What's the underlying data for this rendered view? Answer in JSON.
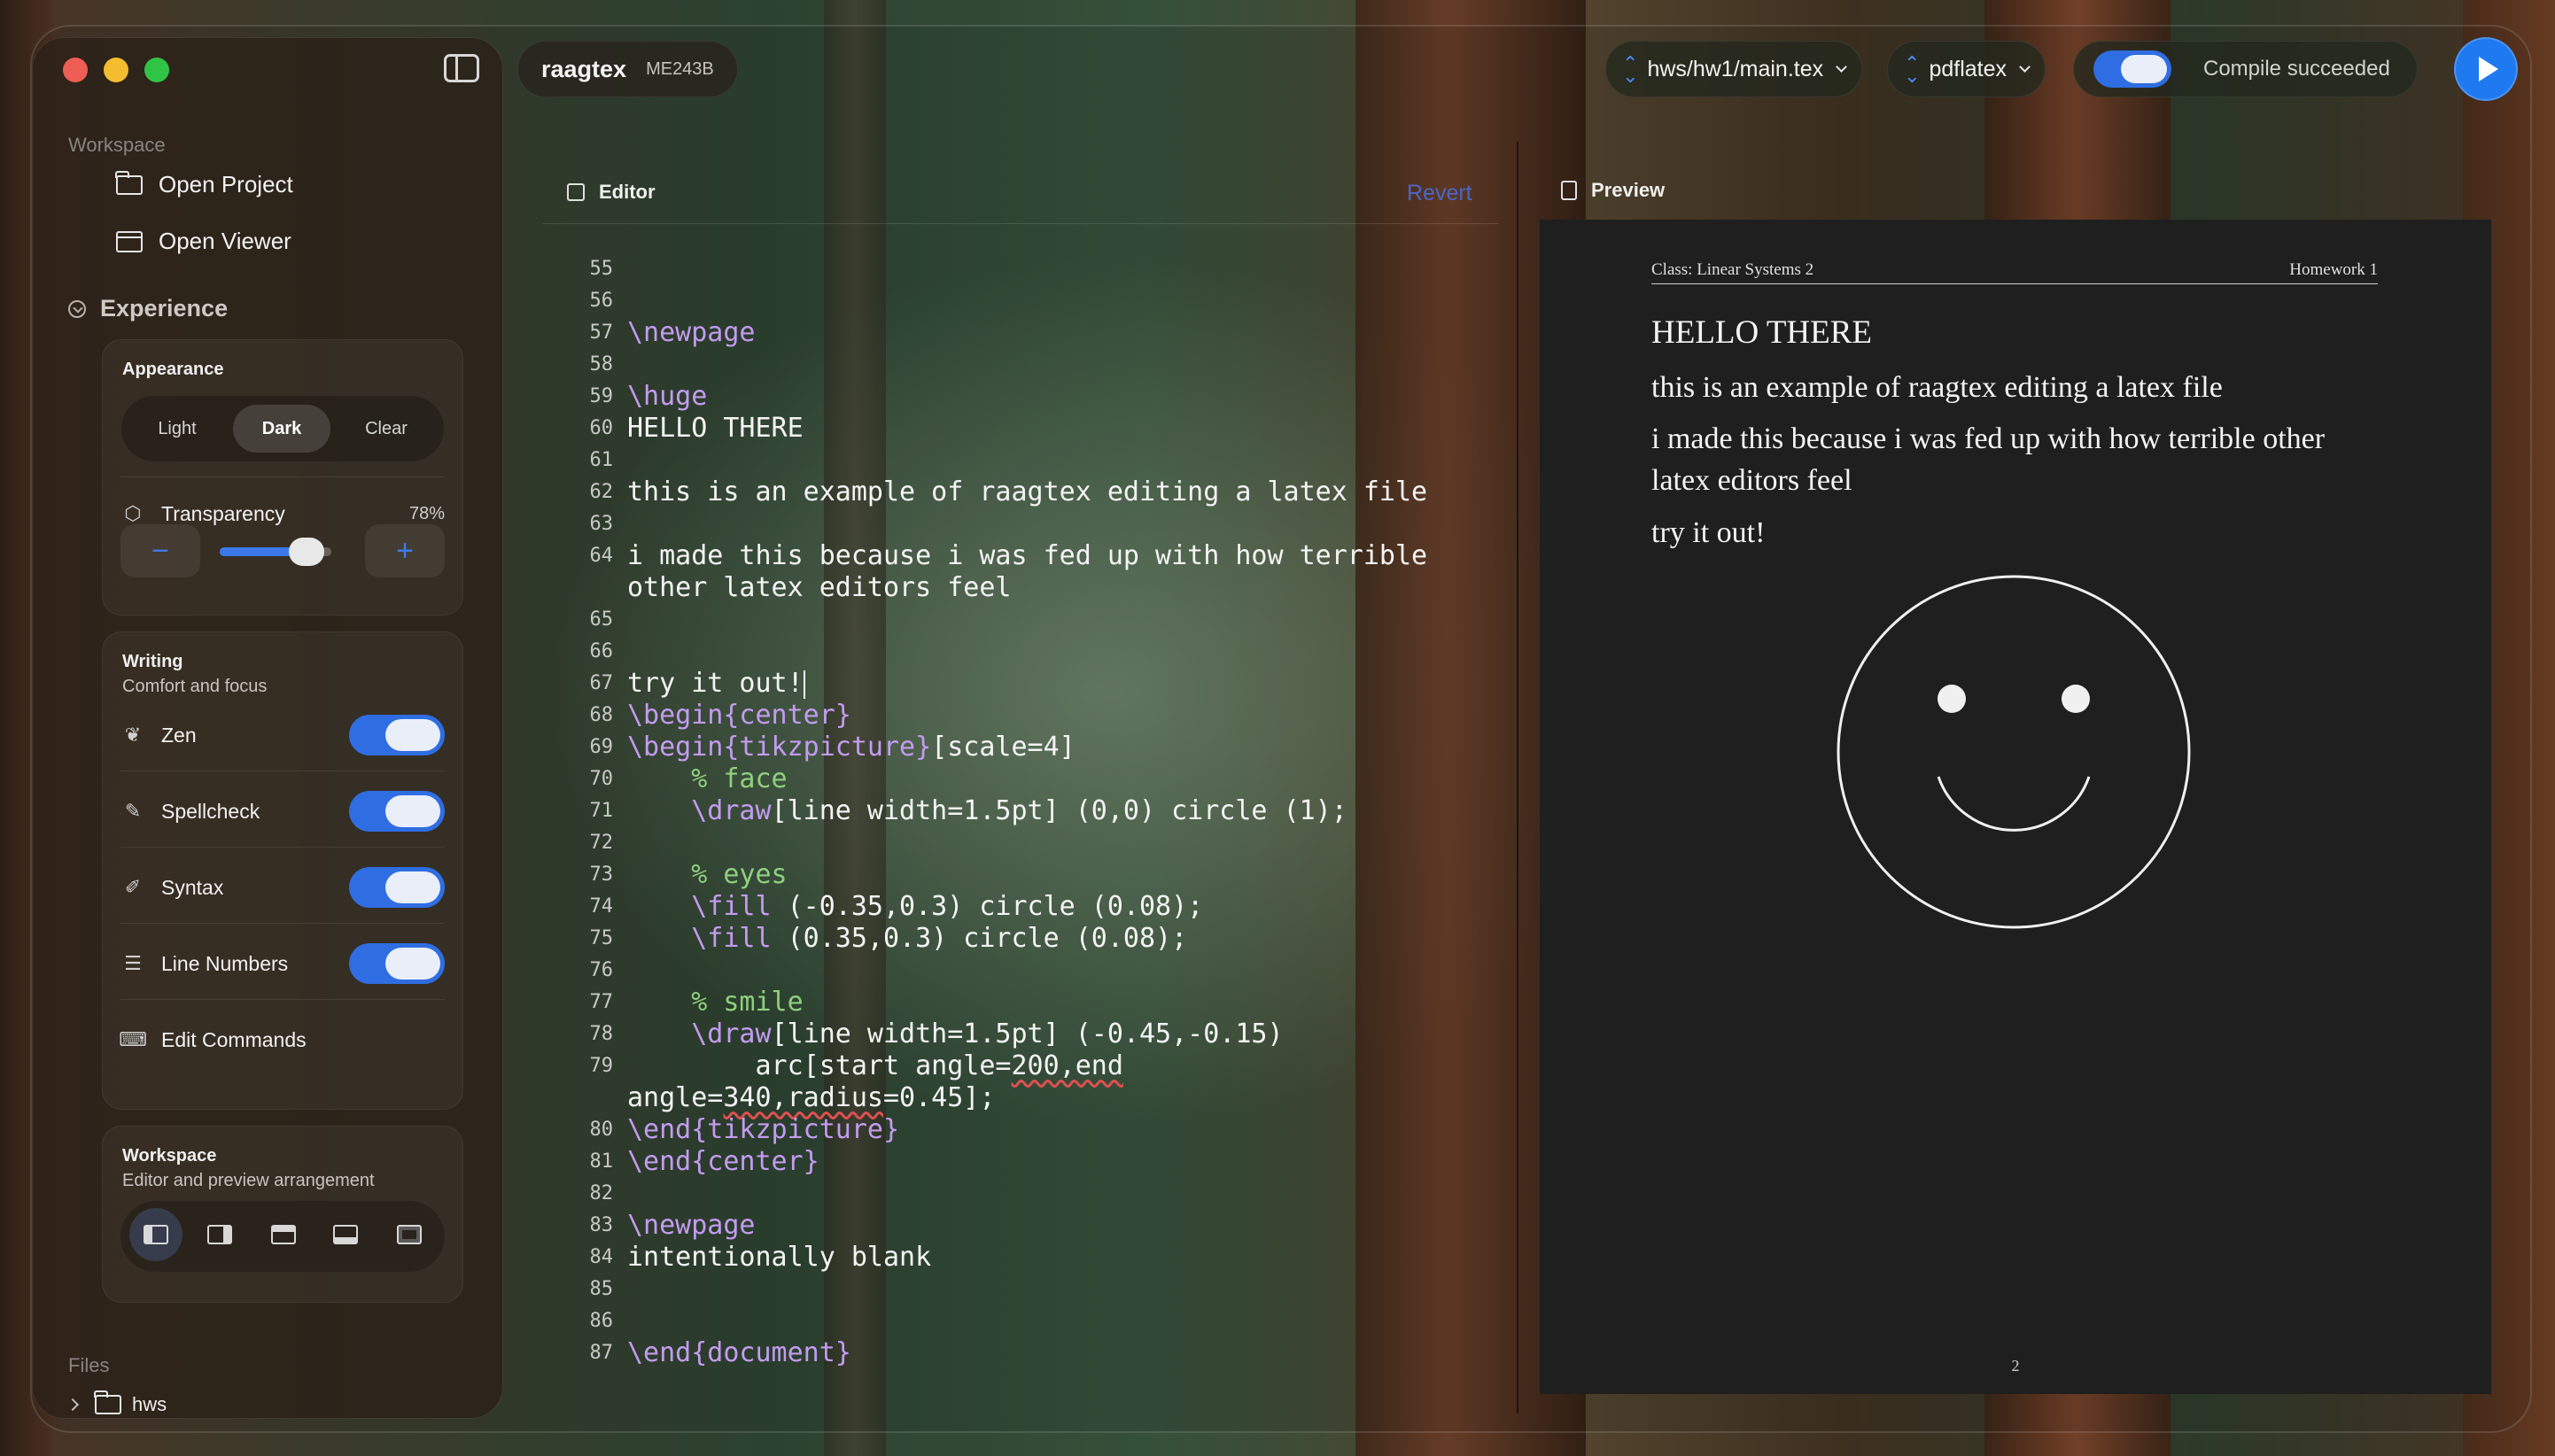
{
  "sidebar": {
    "workspace_label": "Workspace",
    "open_project": "Open Project",
    "open_viewer": "Open Viewer",
    "experience": "Experience",
    "appearance": {
      "title": "Appearance",
      "options": [
        "Light",
        "Dark",
        "Clear"
      ],
      "selected": "Dark"
    },
    "transparency": {
      "label": "Transparency",
      "value": "78%",
      "level": 0.78,
      "minus": "−",
      "plus": "+"
    },
    "writing": {
      "title": "Writing",
      "subtitle": "Comfort and focus",
      "zen": "Zen",
      "spellcheck": "Spellcheck",
      "syntax": "Syntax",
      "line_numbers": "Line Numbers",
      "edit_commands": "Edit Commands"
    },
    "workspace_card": {
      "title": "Workspace",
      "subtitle": "Editor and preview arrangement"
    },
    "files_label": "Files",
    "files": [
      "hws"
    ]
  },
  "topbar": {
    "project_name": "raagtex",
    "project_code": "ME243B",
    "file_select": "hws/hw1/main.tex",
    "engine_select": "pdflatex",
    "status": "Compile succeeded"
  },
  "editor": {
    "title": "Editor",
    "revert": "Revert"
  },
  "code": [
    {
      "n": "55",
      "t": ""
    },
    {
      "n": "56",
      "t": ""
    },
    {
      "n": "57",
      "t": "\\newpage"
    },
    {
      "n": "58",
      "t": ""
    },
    {
      "n": "59",
      "t": "\\huge"
    },
    {
      "n": "60",
      "t": "HELLO THERE"
    },
    {
      "n": "61",
      "t": ""
    },
    {
      "n": "62",
      "t": "this is an example of raagtex editing a latex file"
    },
    {
      "n": "63",
      "t": ""
    },
    {
      "n": "64",
      "t": "i made this because i was fed up with how terrible"
    },
    {
      "n": "",
      "t": "other latex editors feel"
    },
    {
      "n": "65",
      "t": ""
    },
    {
      "n": "66",
      "t": ""
    },
    {
      "n": "67",
      "t": "try it out!"
    },
    {
      "n": "68",
      "t": "\\begin{center}"
    },
    {
      "n": "69",
      "t": "\\begin{tikzpicture}[scale=4]"
    },
    {
      "n": "70",
      "t": "    % face"
    },
    {
      "n": "71",
      "t": "    \\draw[line width=1.5pt] (0,0) circle (1);"
    },
    {
      "n": "72",
      "t": ""
    },
    {
      "n": "73",
      "t": "    % eyes"
    },
    {
      "n": "74",
      "t": "    \\fill (-0.35,0.3) circle (0.08);"
    },
    {
      "n": "75",
      "t": "    \\fill (0.35,0.3) circle (0.08);"
    },
    {
      "n": "76",
      "t": ""
    },
    {
      "n": "77",
      "t": "    % smile"
    },
    {
      "n": "78",
      "t": "    \\draw[line width=1.5pt] (-0.45,-0.15)"
    },
    {
      "n": "79",
      "t": "        arc[start angle=200,end"
    },
    {
      "n": "",
      "t": "angle=340,radius=0.45];"
    },
    {
      "n": "80",
      "t": "\\end{tikzpicture}"
    },
    {
      "n": "81",
      "t": "\\end{center}"
    },
    {
      "n": "82",
      "t": ""
    },
    {
      "n": "83",
      "t": "\\newpage"
    },
    {
      "n": "84",
      "t": "intentionally blank"
    },
    {
      "n": "85",
      "t": ""
    },
    {
      "n": "86",
      "t": ""
    },
    {
      "n": "87",
      "t": "\\end{document}"
    }
  ],
  "preview": {
    "title": "Preview",
    "header_left": "Class: Linear Systems 2",
    "header_right": "Homework 1",
    "heading": "HELLO THERE",
    "line1": "this is an example of raagtex editing a latex file",
    "line2a": "i made this because i was fed up with how terrible other",
    "line2b": "latex editors feel",
    "line3": "try it out!",
    "page_number": "2"
  },
  "colors": {
    "accent": "#2f6de2",
    "command": "#c49bf0",
    "comment": "#8fd07e",
    "revert": "#4a66c8"
  }
}
